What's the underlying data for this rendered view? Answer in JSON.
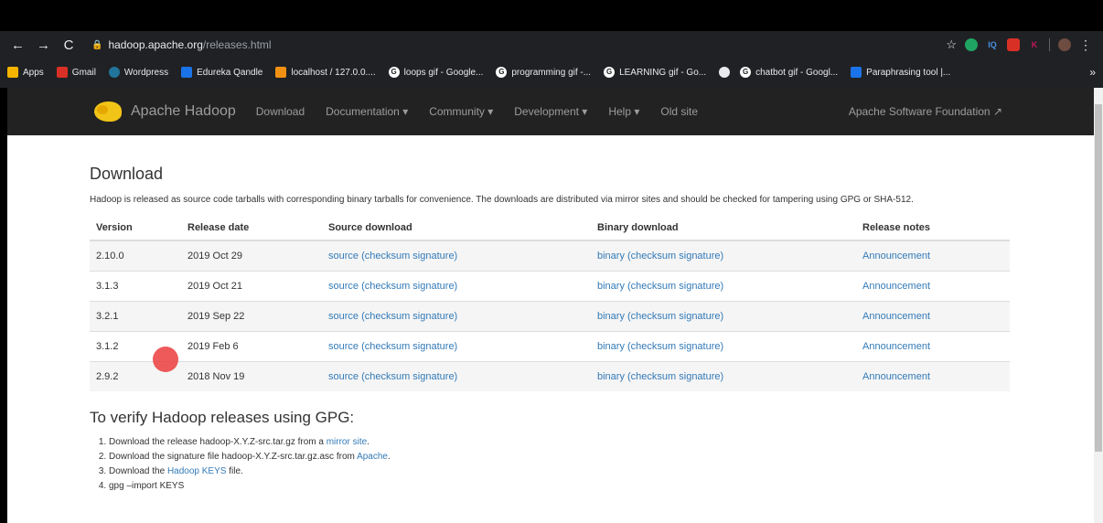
{
  "browser": {
    "url_host": "hadoop.apache.org",
    "url_path": "/releases.html",
    "bookmarks": [
      {
        "label": "Apps"
      },
      {
        "label": "Gmail"
      },
      {
        "label": "Wordpress"
      },
      {
        "label": "Edureka Qandle"
      },
      {
        "label": "localhost / 127.0.0...."
      },
      {
        "label": "loops gif - Google..."
      },
      {
        "label": "programming gif -..."
      },
      {
        "label": "LEARNING gif - Go..."
      },
      {
        "label": ""
      },
      {
        "label": "chatbot gif - Googl..."
      },
      {
        "label": "Paraphrasing tool |..."
      }
    ],
    "ext_labels": [
      "IQ",
      "K"
    ]
  },
  "nav": {
    "brand": "Apache Hadoop",
    "items": [
      "Download",
      "Documentation ▾",
      "Community ▾",
      "Development ▾",
      "Help ▾",
      "Old site"
    ],
    "asf": "Apache Software Foundation"
  },
  "page": {
    "title": "Download",
    "intro": "Hadoop is released as source code tarballs with corresponding binary tarballs for convenience. The downloads are distributed via mirror sites and should be checked for tampering using GPG or SHA-512.",
    "table": {
      "headers": [
        "Version",
        "Release date",
        "Source download",
        "Binary download",
        "Release notes"
      ],
      "rows": [
        {
          "version": "2.10.0",
          "date": "2019 Oct 29",
          "source": "source (checksum signature)",
          "binary": "binary (checksum signature)",
          "notes": "Announcement"
        },
        {
          "version": "3.1.3",
          "date": "2019 Oct 21",
          "source": "source (checksum signature)",
          "binary": "binary (checksum signature)",
          "notes": "Announcement"
        },
        {
          "version": "3.2.1",
          "date": "2019 Sep 22",
          "source": "source (checksum signature)",
          "binary": "binary (checksum signature)",
          "notes": "Announcement"
        },
        {
          "version": "3.1.2",
          "date": "2019 Feb 6",
          "source": "source (checksum signature)",
          "binary": "binary (checksum signature)",
          "notes": "Announcement"
        },
        {
          "version": "2.9.2",
          "date": "2018 Nov 19",
          "source": "source (checksum signature)",
          "binary": "binary (checksum signature)",
          "notes": "Announcement"
        }
      ]
    },
    "verify_title": "To verify Hadoop releases using GPG:",
    "steps": {
      "s1_pre": "Download the release hadoop-X.Y.Z-src.tar.gz from a ",
      "s1_link": "mirror site",
      "s1_post": ".",
      "s2_pre": "Download the signature file hadoop-X.Y.Z-src.tar.gz.asc from ",
      "s2_link": "Apache",
      "s2_post": ".",
      "s3_pre": "Download the ",
      "s3_link": "Hadoop KEYS",
      "s3_post": " file.",
      "s4": "gpg –import KEYS"
    }
  },
  "colors": {
    "link": "#337ab7",
    "navbar": "#222222",
    "cursor": "#eb3c3c"
  }
}
